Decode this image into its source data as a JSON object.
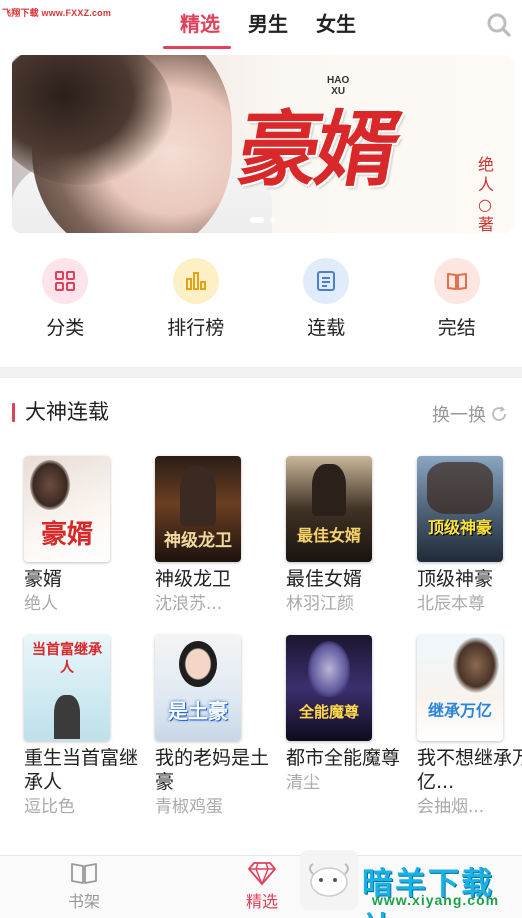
{
  "watermark": "飞翔下载 www.FXXZ.com",
  "header": {
    "tabs": [
      {
        "label": "精选",
        "active": true
      },
      {
        "label": "男生",
        "active": false
      },
      {
        "label": "女生",
        "active": false
      }
    ],
    "search_icon": "search-icon",
    "accent": "#e0405a"
  },
  "banner": {
    "title": "豪婿",
    "subtitle_top": "HAO",
    "subtitle_bottom": "XU",
    "author": "绝人○著"
  },
  "quick_links": [
    {
      "label": "分类",
      "icon": "grid-icon",
      "bg": "#fde3ea",
      "fg": "#e0405a"
    },
    {
      "label": "排行榜",
      "icon": "bar-chart-icon",
      "bg": "#fdf0c4",
      "fg": "#e3a11a"
    },
    {
      "label": "连载",
      "icon": "document-icon",
      "bg": "#e1ecfb",
      "fg": "#4a7fd4"
    },
    {
      "label": "完结",
      "icon": "open-book-icon",
      "bg": "#fde5e0",
      "fg": "#e07050"
    }
  ],
  "section": {
    "title": "大神连载",
    "refresh_label": "换一换",
    "refresh_icon": "refresh-icon"
  },
  "books": [
    {
      "title": "豪婿",
      "author": "绝人",
      "cover_text": "豪婿"
    },
    {
      "title": "神级龙卫",
      "author": "沈浪苏...",
      "cover_text": "神级龙卫"
    },
    {
      "title": "最佳女婿",
      "author": "林羽江颜",
      "cover_text": "最佳女婿"
    },
    {
      "title": "顶级神豪",
      "author": "北辰本尊",
      "cover_text": "顶级神豪"
    },
    {
      "title": "重生当首富继承人",
      "author": "逗比色",
      "cover_text": "当首富继承人"
    },
    {
      "title": "我的老妈是土豪",
      "author": "青椒鸡蛋",
      "cover_text": "是土豪"
    },
    {
      "title": "都市全能魔尊",
      "author": "清尘",
      "cover_text": "全能魔尊"
    },
    {
      "title": "我不想继承万亿...",
      "author": "会抽烟...",
      "cover_text": "继承万亿"
    }
  ],
  "bottom_nav": [
    {
      "label": "书架",
      "icon": "bookshelf-icon",
      "active": false
    },
    {
      "label": "精选",
      "icon": "diamond-icon",
      "active": true
    }
  ],
  "brand": {
    "main": "暗羊下载站",
    "url": "www.xiyang.com"
  }
}
